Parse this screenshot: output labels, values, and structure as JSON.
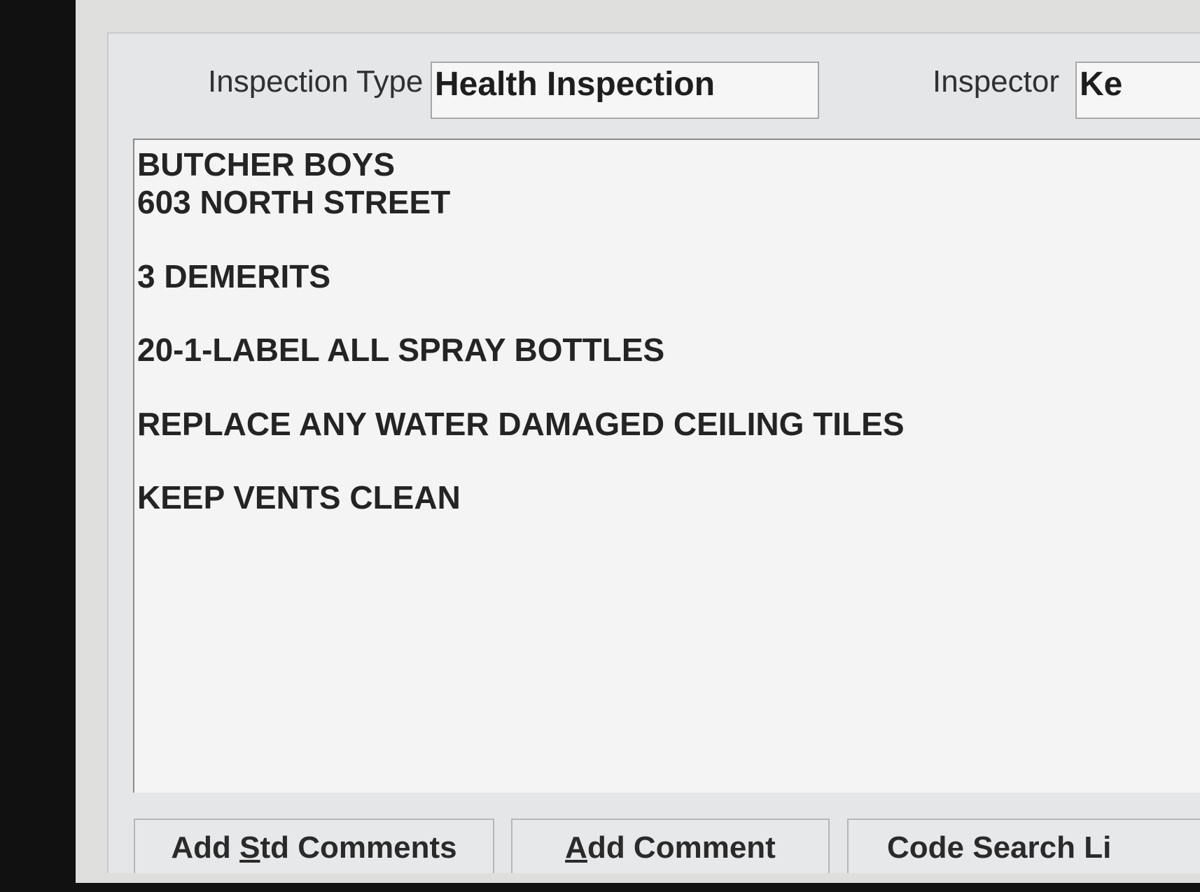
{
  "form": {
    "inspection_type_label": "Inspection Type",
    "inspection_type_value": "Health Inspection",
    "inspector_label": "Inspector",
    "inspector_value": "Ke"
  },
  "comments": {
    "lines": [
      "BUTCHER BOYS",
      "603 NORTH STREET",
      "3 DEMERITS",
      "20-1-LABEL ALL SPRAY BOTTLES",
      "REPLACE ANY WATER DAMAGED CEILING TILES",
      "KEEP VENTS CLEAN"
    ]
  },
  "buttons": {
    "add_std_comments": {
      "pre": "Add ",
      "key": "S",
      "post": "td Comments"
    },
    "add_comment": {
      "pre": "",
      "key": "A",
      "post": "dd Comment"
    },
    "code_search": {
      "label": "Code Search Li"
    }
  },
  "colors": {
    "background_scan": "#111111",
    "window": "#e4e6e8",
    "field_bg": "#f6f6f6"
  }
}
